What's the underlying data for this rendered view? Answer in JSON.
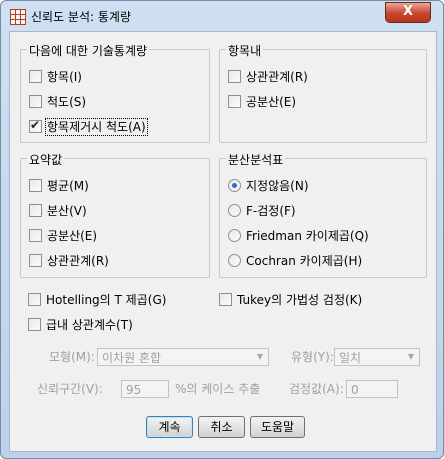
{
  "window": {
    "title": "신뢰도 분석: 통계량",
    "close_glyph": "X"
  },
  "descriptives": {
    "title": "다음에 대한 기술통계량",
    "items": [
      {
        "label": "항목(I)",
        "checked": false
      },
      {
        "label": "척도(S)",
        "checked": false
      },
      {
        "label": "항목제거시 척도(A)",
        "checked": true
      }
    ]
  },
  "inter_item": {
    "title": "항목내",
    "items": [
      {
        "label": "상관관계(R)",
        "checked": false
      },
      {
        "label": "공분산(E)",
        "checked": false
      }
    ]
  },
  "summaries": {
    "title": "요약값",
    "items": [
      {
        "label": "평균(M)",
        "checked": false
      },
      {
        "label": "분산(V)",
        "checked": false
      },
      {
        "label": "공분산(E)",
        "checked": false
      },
      {
        "label": "상관관계(R)",
        "checked": false
      }
    ]
  },
  "anova": {
    "title": "분산분석표",
    "options": [
      {
        "label": "지정않음(N)",
        "selected": true
      },
      {
        "label": "F-검정(F)",
        "selected": false
      },
      {
        "label": "Friedman 카이제곱(Q)",
        "selected": false
      },
      {
        "label": "Cochran 카이제곱(H)",
        "selected": false
      }
    ]
  },
  "extra": {
    "hotelling": {
      "label": "Hotelling의 T 제곱(G)",
      "checked": false
    },
    "tukey": {
      "label": "Tukey의 가법성 검정(K)",
      "checked": false
    },
    "icc": {
      "label": "급내 상관계수(T)",
      "checked": false
    }
  },
  "icc_options": {
    "model_label": "모형(M):",
    "model_value": "이차원 혼합",
    "type_label": "유형(Y):",
    "type_value": "일치",
    "ci_label": "신뢰구간(V):",
    "ci_value": "95",
    "ci_suffix": "%의 케이스 추출",
    "test_label": "검정값(A):",
    "test_value": "0"
  },
  "buttons": {
    "continue": "계속",
    "cancel": "취소",
    "help": "도움말"
  }
}
